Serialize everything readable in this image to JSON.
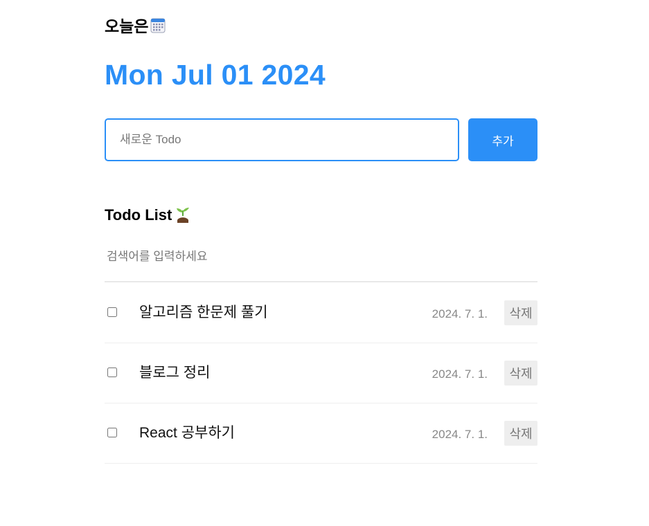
{
  "header": {
    "today_label": "오늘은",
    "today_icon": "calendar-icon",
    "date_title": "Mon Jul 01 2024",
    "accent_color": "#2b8ff7"
  },
  "editor": {
    "input_placeholder": "새로운 Todo",
    "input_value": "",
    "add_label": "추가"
  },
  "list": {
    "title": "Todo List",
    "title_icon": "sprout-icon",
    "search_placeholder": "검색어를 입력하세요",
    "search_value": "",
    "items": [
      {
        "content": "알고리즘 한문제 풀기",
        "date": "2024. 7. 1.",
        "done": false,
        "delete_label": "삭제"
      },
      {
        "content": "블로그 정리",
        "date": "2024. 7. 1.",
        "done": false,
        "delete_label": "삭제"
      },
      {
        "content": "React 공부하기",
        "date": "2024. 7. 1.",
        "done": false,
        "delete_label": "삭제"
      }
    ]
  }
}
